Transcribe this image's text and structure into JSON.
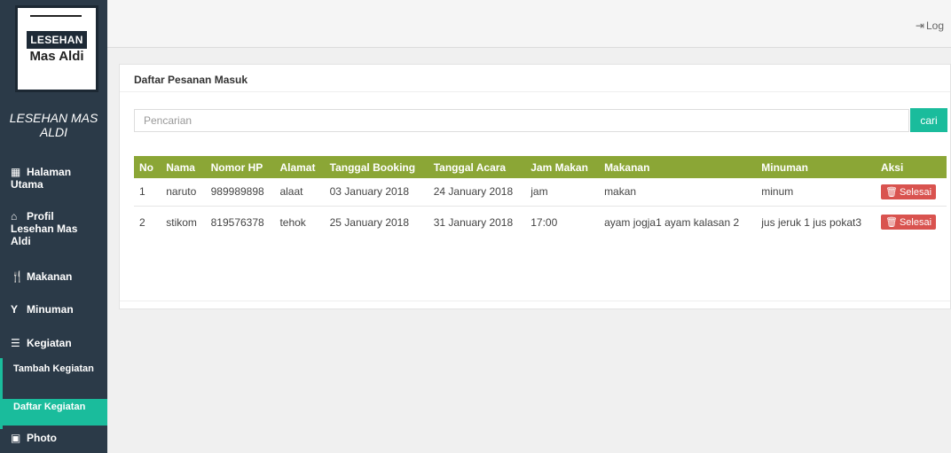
{
  "sidebar": {
    "logo": {
      "line1": "LESEHAN",
      "line2": "Mas Aldi"
    },
    "brand": "LESEHAN MAS ALDI",
    "menu": {
      "home": {
        "icon": "grid-icon",
        "label": "Halaman Utama"
      },
      "profil": {
        "icon": "home-icon",
        "label": "Profil Lesehan Mas Aldi"
      },
      "makanan": {
        "icon": "cutlery-icon",
        "label": "Makanan"
      },
      "minuman": {
        "icon": "glass-icon",
        "label": "Minuman"
      },
      "kegiatan": {
        "icon": "list-icon",
        "label": "Kegiatan"
      },
      "photo": {
        "icon": "picture-icon",
        "label": "Photo"
      }
    },
    "submenu": {
      "tambah": "Tambah Kegiatan",
      "daftar": "Daftar Kegiatan"
    }
  },
  "topbar": {
    "logout_label": "Log"
  },
  "panel": {
    "title": "Daftar Pesanan Masuk",
    "search": {
      "placeholder": "Pencarian",
      "value": "",
      "button_label": "cari"
    },
    "table": {
      "headers": [
        "No",
        "Nama",
        "Nomor HP",
        "Alamat",
        "Tanggal Booking",
        "Tanggal Acara",
        "Jam Makan",
        "Makanan",
        "Minuman",
        "Aksi"
      ],
      "rows": [
        [
          "1",
          "naruto",
          "989989898",
          "alaat",
          "03 January 2018",
          "24 January 2018",
          "jam",
          "makan",
          "minum"
        ],
        [
          "2",
          "stikom",
          "819576378",
          "tehok",
          "25 January 2018",
          "31 January 2018",
          "17:00",
          "ayam jogja1 ayam kalasan 2",
          "jus jeruk 1 jus pokat3"
        ]
      ],
      "action_label": "Selesai"
    }
  },
  "colors": {
    "sidebar": "#2b3a48",
    "accent": "#1abc9c",
    "table_header": "#8ba636",
    "danger": "#d9534f"
  }
}
